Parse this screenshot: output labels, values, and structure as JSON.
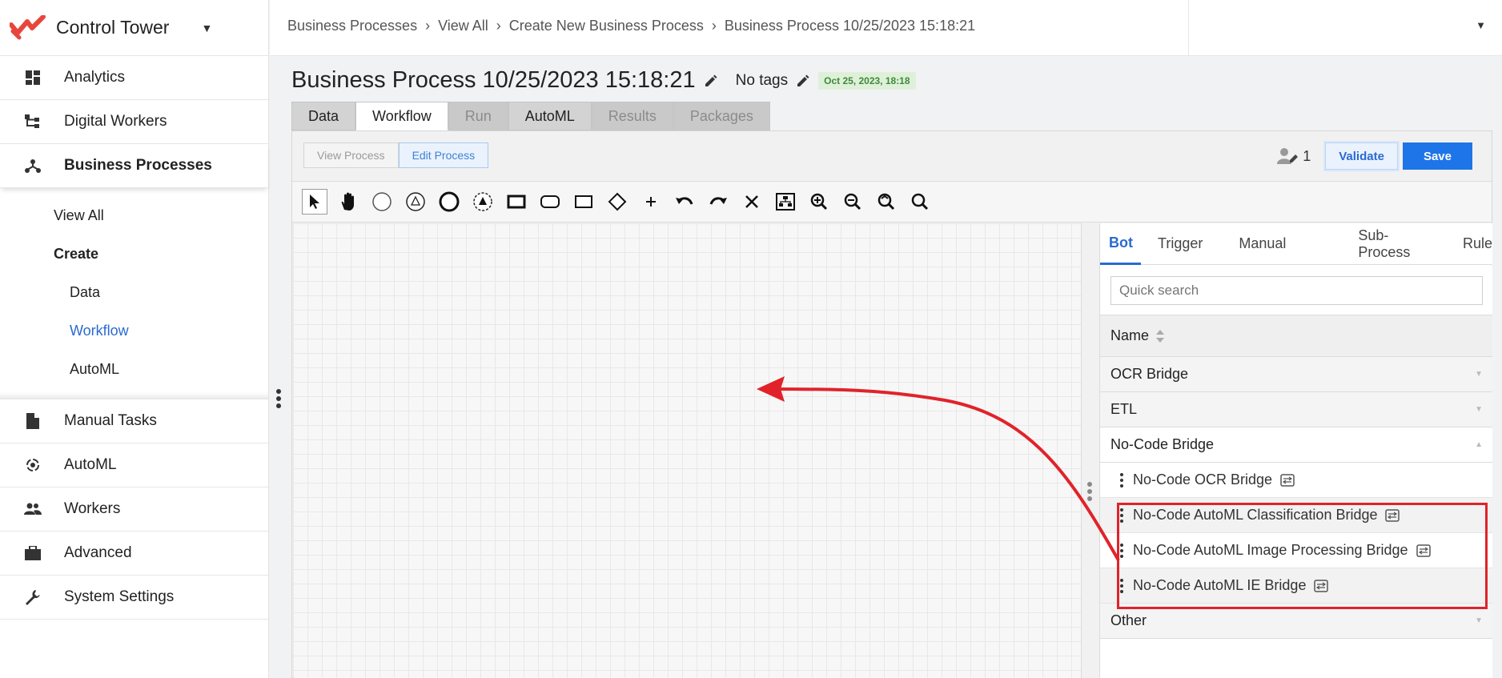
{
  "app": {
    "name": "Control Tower"
  },
  "sidebar": {
    "items_top": [
      {
        "label": "Analytics",
        "icon": "dashboard-icon"
      },
      {
        "label": "Digital Workers",
        "icon": "hierarchy-icon"
      },
      {
        "label": "Business Processes",
        "icon": "flow-icon"
      }
    ],
    "subnav": {
      "view_all": "View All",
      "create": "Create",
      "data": "Data",
      "workflow": "Workflow",
      "automl": "AutoML"
    },
    "items_bottom": [
      {
        "label": "Manual Tasks",
        "icon": "document-icon"
      },
      {
        "label": "AutoML",
        "icon": "automl-icon"
      },
      {
        "label": "Workers",
        "icon": "people-icon"
      },
      {
        "label": "Advanced",
        "icon": "briefcase-icon"
      },
      {
        "label": "System Settings",
        "icon": "wrench-icon"
      }
    ]
  },
  "breadcrumb": [
    "Business Processes",
    "View All",
    "Create New Business Process",
    "Business Process 10/25/2023 15:18:21"
  ],
  "page": {
    "title": "Business Process 10/25/2023 15:18:21",
    "tags": "No tags",
    "date_badge": "Oct 25, 2023, 18:18"
  },
  "tabs": [
    {
      "label": "Data",
      "state": "normal"
    },
    {
      "label": "Workflow",
      "state": "active"
    },
    {
      "label": "Run",
      "state": "disabled"
    },
    {
      "label": "AutoML",
      "state": "normal"
    },
    {
      "label": "Results",
      "state": "disabled"
    },
    {
      "label": "Packages",
      "state": "disabled"
    }
  ],
  "editor": {
    "view_process": "View Process",
    "edit_process": "Edit Process",
    "assignee_count": "1",
    "validate": "Validate",
    "save": "Save"
  },
  "palette": {
    "tabs": [
      "Bot",
      "Trigger",
      "Manual",
      "Sub-Process",
      "Rule"
    ],
    "search_placeholder": "Quick search",
    "name_header": "Name",
    "groups": {
      "ocr": "OCR Bridge",
      "etl": "ETL",
      "nocode": "No-Code Bridge",
      "other": "Other"
    },
    "nocode_items": [
      "No-Code OCR Bridge",
      "No-Code AutoML Classification Bridge",
      "No-Code AutoML Image Processing Bridge",
      "No-Code AutoML IE Bridge"
    ]
  },
  "colors": {
    "accent": "#2a6ad1",
    "save": "#1e75e8",
    "annotation": "#e0232a",
    "brand": "#e8453c"
  }
}
